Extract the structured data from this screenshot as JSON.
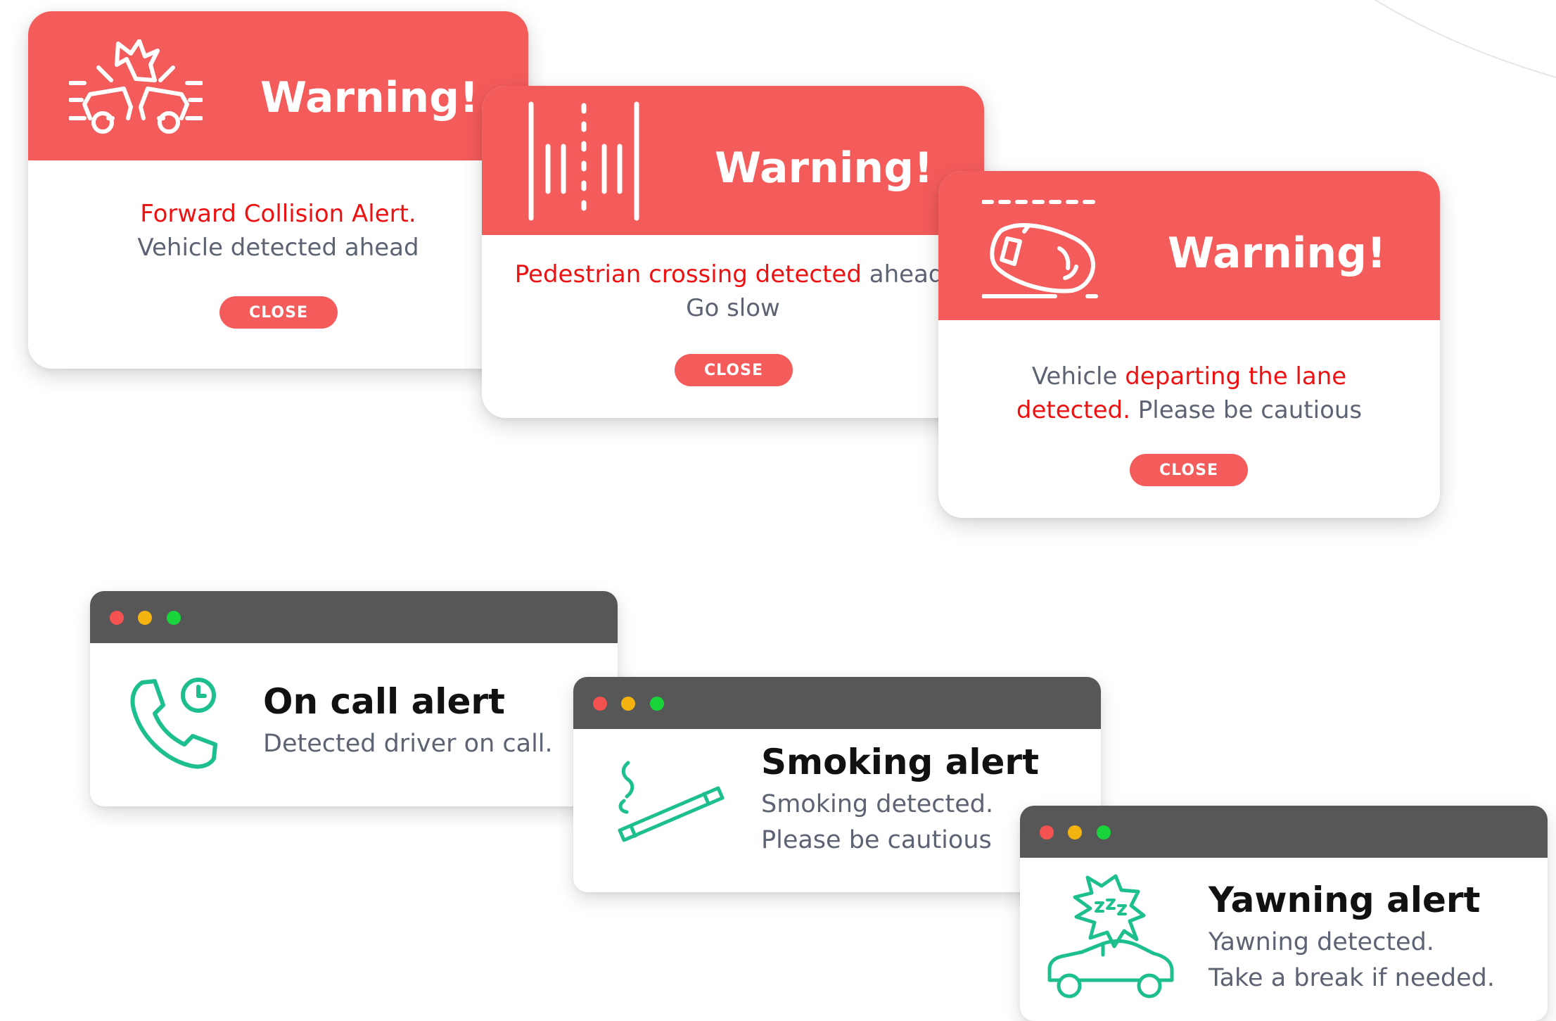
{
  "warnings": [
    {
      "icon": "collision-icon",
      "title": "Warning!",
      "line1": [
        {
          "text": "Forward Collision Alert.",
          "highlight": true
        }
      ],
      "line2": [
        {
          "text": "Vehicle detected ahead",
          "highlight": false
        }
      ],
      "close_label": "CLOSE"
    },
    {
      "icon": "pedestrian-crossing-icon",
      "title": "Warning!",
      "line1": [
        {
          "text": "Pedestrian crossing detected",
          "highlight": true
        },
        {
          "text": " ahead.",
          "highlight": false
        }
      ],
      "line2": [
        {
          "text": "Go slow",
          "highlight": false
        }
      ],
      "close_label": "CLOSE"
    },
    {
      "icon": "lane-departure-icon",
      "title": "Warning!",
      "line1": [
        {
          "text": "Vehicle ",
          "highlight": false
        },
        {
          "text": "departing the lane",
          "highlight": true
        }
      ],
      "line2": [
        {
          "text": "detected.",
          "highlight": true
        },
        {
          "text": " Please be cautious",
          "highlight": false
        }
      ],
      "close_label": "CLOSE"
    }
  ],
  "alerts": [
    {
      "icon": "phone-clock-icon",
      "title": "On call alert",
      "line1": "Detected driver on call.",
      "line2": ""
    },
    {
      "icon": "cigarette-icon",
      "title": "Smoking alert",
      "line1": "Smoking detected.",
      "line2": "Please be cautious"
    },
    {
      "icon": "sleepy-car-icon",
      "title": "Yawning alert",
      "line1": "Yawning detected.",
      "line2": "Take a break if needed."
    }
  ],
  "colors": {
    "warning_red": "#f45b5b",
    "highlight_red": "#ee1111",
    "body_text": "#5d6373",
    "icon_green": "#1ebf8f",
    "window_bar": "#575757"
  }
}
